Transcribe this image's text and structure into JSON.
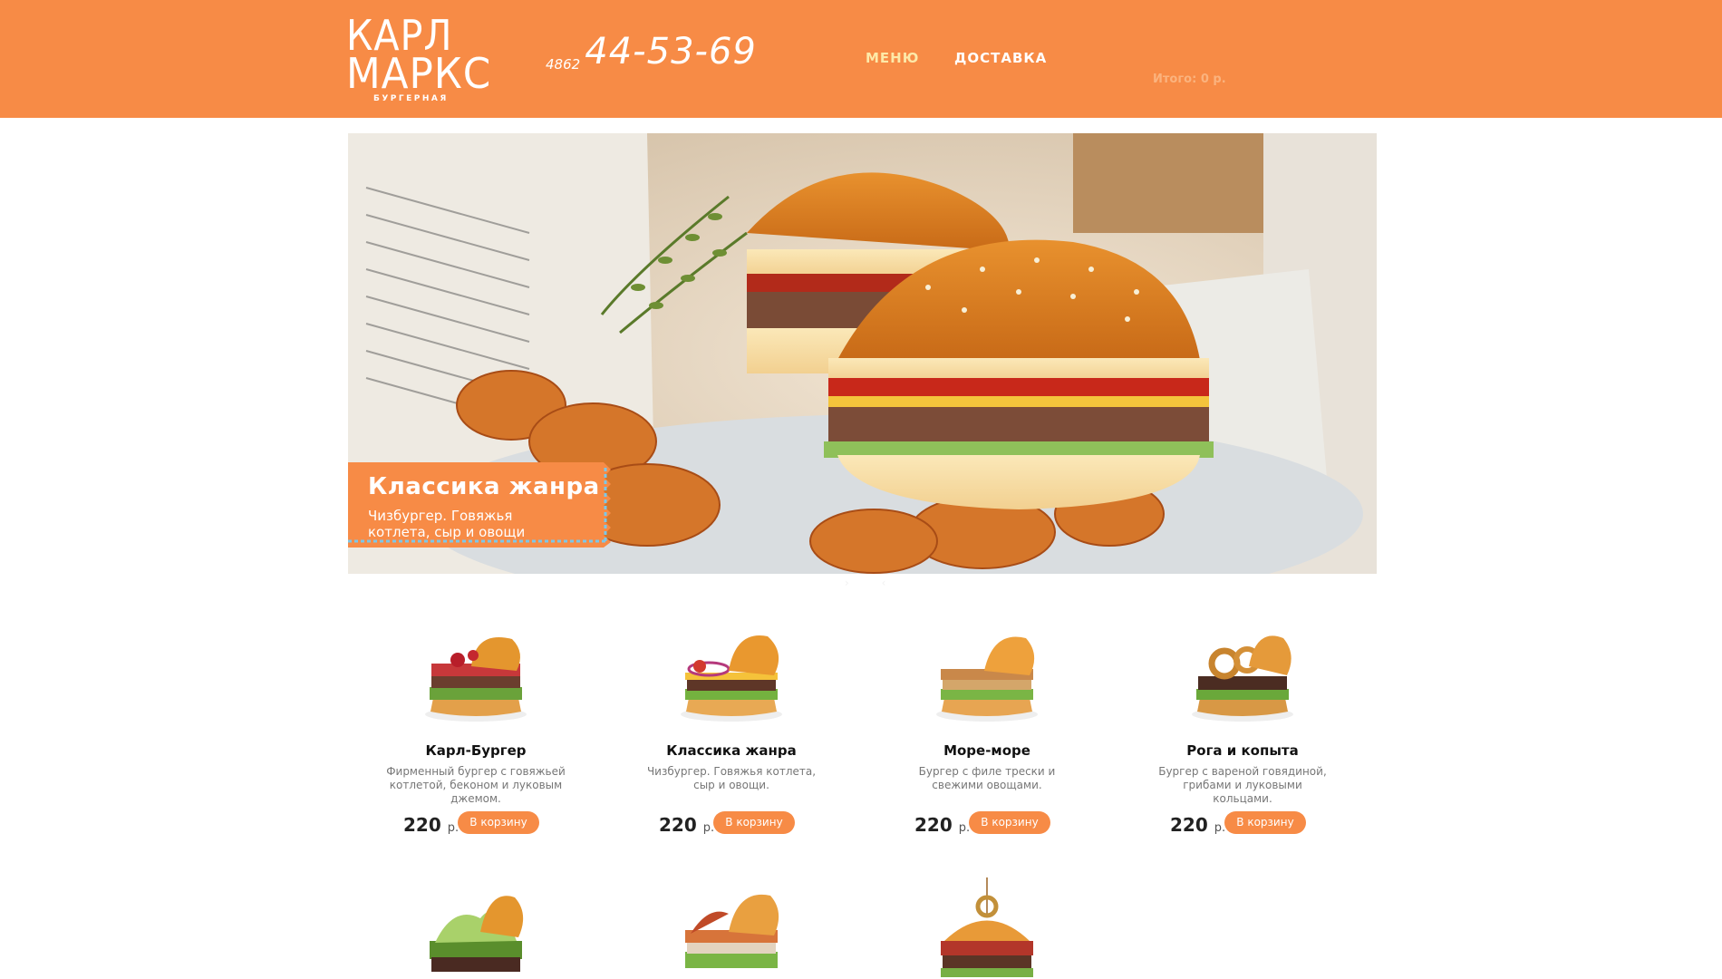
{
  "header": {
    "logo": {
      "line1": "КАРЛ",
      "line2": "МАРКС",
      "sub": "БУРГЕРНАЯ"
    },
    "phone": {
      "code": "4862",
      "number": "44-53-69"
    },
    "nav": [
      {
        "label": "МЕНЮ"
      },
      {
        "label": "ДОСТАВКА"
      }
    ],
    "cart": {
      "label": "Итого:",
      "total": "0",
      "currency": "р."
    }
  },
  "hero": {
    "title": "Классика жанра",
    "description": "Чизбургер. Говяжья котлета, сыр и овощи",
    "dots": "› ‹"
  },
  "products": [
    {
      "name": "Карл-Бургер",
      "description": "Фирменный бургер с говяжьей котлетой, беконом и луковым джемом.",
      "price": "220",
      "currency": "р.",
      "button": "В корзину",
      "icon": "burger-bacon-icon"
    },
    {
      "name": "Классика жанра",
      "description": "Чизбургер. Говяжья котлета, сыр и овощи.",
      "price": "220",
      "currency": "р.",
      "button": "В корзину",
      "icon": "burger-cheese-icon"
    },
    {
      "name": "Море-море",
      "description": "Бургер с филе трески и свежими овощами.",
      "price": "220",
      "currency": "р.",
      "button": "В корзину",
      "icon": "burger-fish-icon"
    },
    {
      "name": "Рога и копыта",
      "description": "Бургер с вареной говядиной, грибами и луковыми кольцами.",
      "price": "220",
      "currency": "р.",
      "button": "В корзину",
      "icon": "burger-onion-rings-icon"
    }
  ],
  "colors": {
    "accent": "#f78b46",
    "nav_active": "#fde9a8",
    "button": "#f78b46"
  }
}
